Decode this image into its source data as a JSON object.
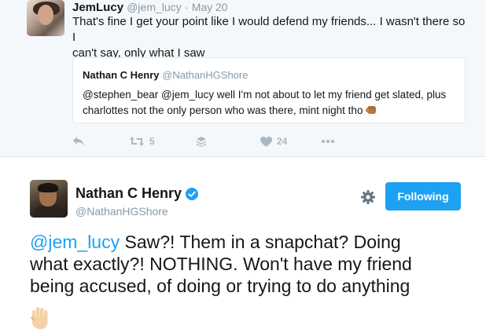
{
  "top_tweet": {
    "name": "JemLucy",
    "handle": "@jem_lucy",
    "separator": "·",
    "date": "May 20",
    "text_line1": "That's fine I get your point like I would defend my friends... I wasn't there so I",
    "text_line2": "can't say, only what I saw",
    "quoted": {
      "name": "Nathan C Henry",
      "handle": "@NathanHGShore",
      "text_line1": "@stephen_bear @jem_lucy well I'm not about to let my friend get slated, plus",
      "text_line2": "charlottes not the only person who was there, mint night tho"
    },
    "actions": {
      "reply_icon": "reply-icon",
      "retweet_icon": "retweet-icon",
      "retweet_count": "5",
      "buffer_icon": "stack-icon",
      "like_icon": "heart-icon",
      "like_count": "24",
      "more_icon": "more-icon"
    }
  },
  "main_tweet": {
    "name": "Nathan C Henry",
    "handle": "@NathanHGShore",
    "follow_label": "Following",
    "mention": "@jem_lucy",
    "text_line1_rest": " Saw?! Them in a snapchat? Doing",
    "text_line2": "what exactly?! NOTHING. Won't have my friend",
    "text_line3": "being accused, of doing or trying to do anything",
    "emoji": "raised-hand-emoji"
  },
  "colors": {
    "accent": "#1da1f2",
    "muted": "#8899a6",
    "icon_gray": "#aab8c2",
    "background_top": "#f5f8fa"
  }
}
